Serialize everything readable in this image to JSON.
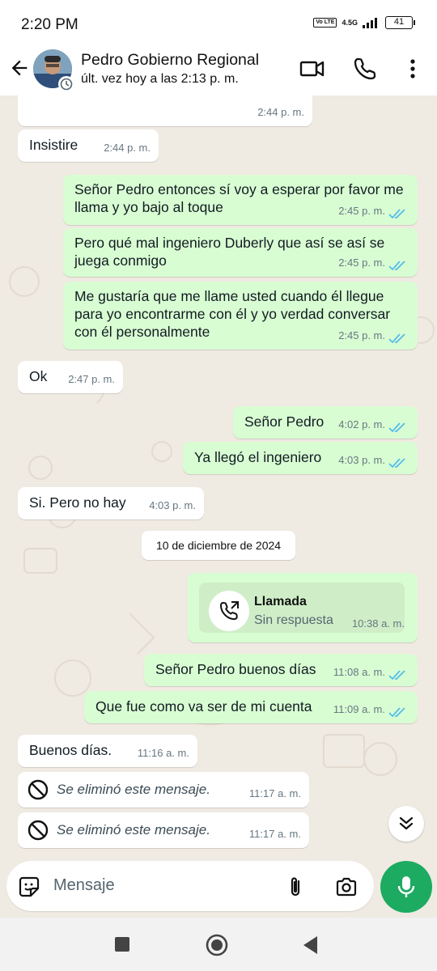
{
  "status_bar": {
    "time": "2:20 PM",
    "volte": "Vo LTE",
    "network": "4.5G",
    "battery": "41"
  },
  "header": {
    "contact_name": "Pedro Gobierno Regional",
    "last_seen": "últ. vez hoy a las 2:13 p. m."
  },
  "messages": [
    {
      "dir": "in",
      "text": "",
      "time": "2:44 p. m."
    },
    {
      "dir": "in",
      "text": "Insistire",
      "time": "2:44 p. m."
    },
    {
      "dir": "out",
      "text": "Señor Pedro entonces sí voy a esperar por favor me llama y yo bajo al toque",
      "time": "2:45 p. m."
    },
    {
      "dir": "out",
      "text": "Pero qué mal ingeniero Duberly que así se así se juega conmigo",
      "time": "2:45 p. m."
    },
    {
      "dir": "out",
      "text": "Me gustaría que me llame usted cuando él llegue para yo encontrarme con él y yo verdad conversar con él personalmente",
      "time": "2:45 p. m."
    },
    {
      "dir": "in",
      "text": "Ok",
      "time": "2:47 p. m."
    },
    {
      "dir": "out",
      "text": "Señor Pedro",
      "time": "4:02 p. m."
    },
    {
      "dir": "out",
      "text": "Ya llegó el ingeniero",
      "time": "4:03 p. m."
    },
    {
      "dir": "in",
      "text": "Si. Pero no hay",
      "time": "4:03 p. m."
    },
    {
      "dir": "out",
      "text": "Señor Pedro buenos días",
      "time": "11:08 a. m."
    },
    {
      "dir": "out",
      "text": "Que fue como va ser de mi cuenta",
      "time": "11:09 a. m."
    },
    {
      "dir": "in",
      "text": "Buenos días.",
      "time": "11:16 a. m."
    },
    {
      "dir": "in",
      "text": "Se eliminó este mensaje.",
      "time": "11:17 a. m."
    },
    {
      "dir": "in",
      "text": "Se eliminó este mensaje.",
      "time": "11:17 a. m."
    }
  ],
  "date_divider": "10 de diciembre de 2024",
  "call": {
    "title": "Llamada",
    "subtitle": "Sin respuesta",
    "time": "10:38 a. m."
  },
  "composer": {
    "placeholder": "Mensaje"
  },
  "colors": {
    "outgoing_bubble": "#d9fdd3",
    "incoming_bubble": "#ffffff",
    "read_tick": "#53bdeb",
    "mic_button": "#1daa61"
  }
}
